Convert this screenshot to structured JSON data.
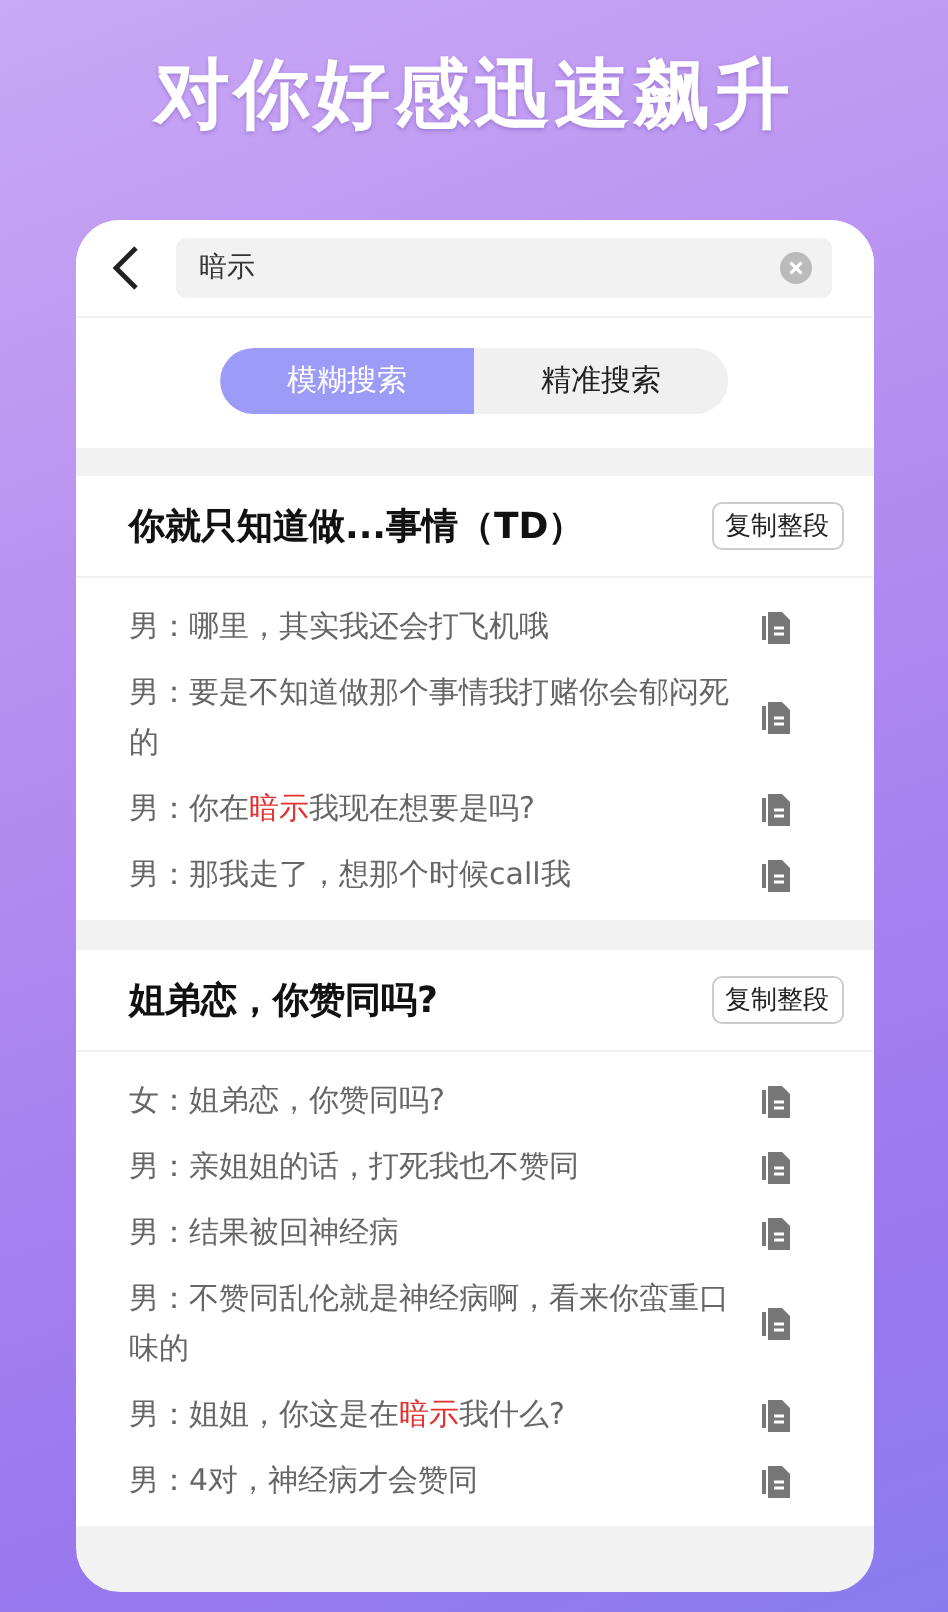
{
  "headline": "对你好感迅速飙升",
  "search": {
    "value": "暗示"
  },
  "tabs": [
    {
      "label": "模糊搜索",
      "selected": true
    },
    {
      "label": "精准搜索",
      "selected": false
    }
  ],
  "sections": [
    {
      "title": "你就只知道做...事情（TD）",
      "copy_button": "复制整段",
      "lines": [
        {
          "parts": [
            {
              "text": "男：哪里，其实我还会打飞机哦",
              "highlight": false
            }
          ]
        },
        {
          "parts": [
            {
              "text": "男：要是不知道做那个事情我打赌你会郁闷死的",
              "highlight": false
            }
          ]
        },
        {
          "parts": [
            {
              "text": "男：你在",
              "highlight": false
            },
            {
              "text": "暗示",
              "highlight": true
            },
            {
              "text": "我现在想要是吗?",
              "highlight": false
            }
          ]
        },
        {
          "parts": [
            {
              "text": "男：那我走了，想那个时候call我",
              "highlight": false
            }
          ]
        }
      ]
    },
    {
      "title": "姐弟恋，你赞同吗?",
      "copy_button": "复制整段",
      "lines": [
        {
          "parts": [
            {
              "text": "女：姐弟恋，你赞同吗?",
              "highlight": false
            }
          ]
        },
        {
          "parts": [
            {
              "text": "男：亲姐姐的话，打死我也不赞同",
              "highlight": false
            }
          ]
        },
        {
          "parts": [
            {
              "text": "男：结果被回神经病",
              "highlight": false
            }
          ]
        },
        {
          "parts": [
            {
              "text": "男：不赞同乱伦就是神经病啊，看来你蛮重口味的",
              "highlight": false
            }
          ]
        },
        {
          "parts": [
            {
              "text": "男：姐姐，你这是在",
              "highlight": false
            },
            {
              "text": "暗示",
              "highlight": true
            },
            {
              "text": "我什么?",
              "highlight": false
            }
          ]
        },
        {
          "parts": [
            {
              "text": "男：4对，神经病才会赞同",
              "highlight": false
            }
          ]
        }
      ]
    }
  ]
}
